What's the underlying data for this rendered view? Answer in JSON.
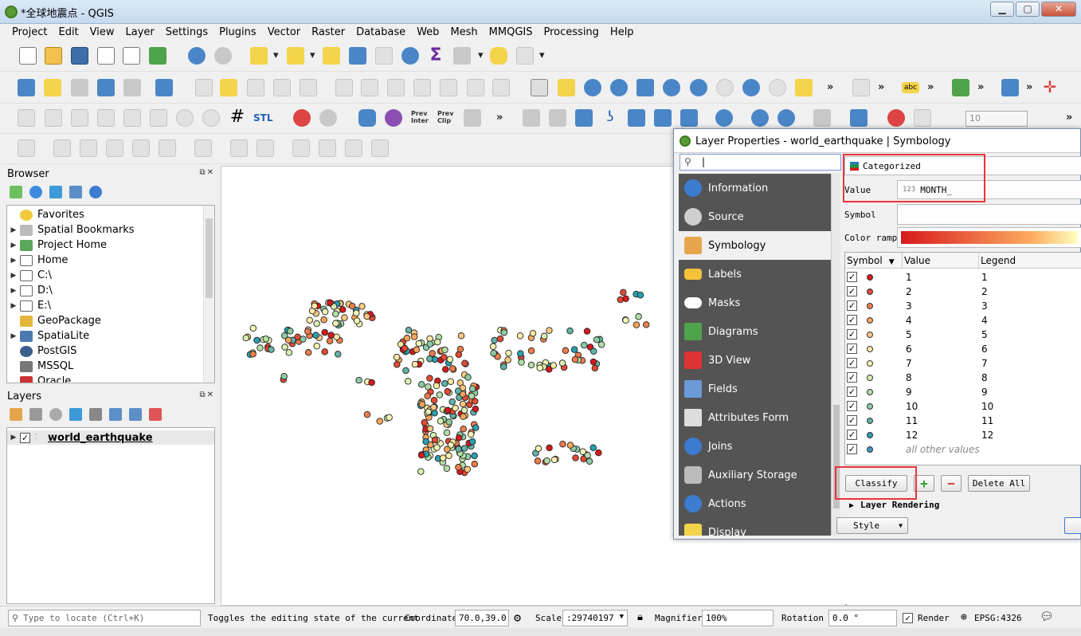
{
  "window": {
    "title": "*全球地震点 - QGIS",
    "min": "▁",
    "max": "▢",
    "close": "✕"
  },
  "menu": [
    "Project",
    "Edit",
    "View",
    "Layer",
    "Settings",
    "Plugins",
    "Vector",
    "Raster",
    "Database",
    "Web",
    "Mesh",
    "MMQGIS",
    "Processing",
    "Help"
  ],
  "toolbar": {
    "stl_label": "STL",
    "prev_inter": "Prev Inter",
    "prev_clip": "Prev Clip",
    "spin_value": "10",
    "more": "»",
    "abc": "abc"
  },
  "browser": {
    "title": "Browser",
    "items": [
      "Favorites",
      "Spatial Bookmarks",
      "Project Home",
      "Home",
      "C:\\",
      "D:\\",
      "E:\\",
      "GeoPackage",
      "SpatiaLite",
      "PostGIS",
      "MSSQL",
      "Oracle"
    ]
  },
  "layers": {
    "title": "Layers",
    "layer_name": "world_earthquake"
  },
  "dialog": {
    "title": "Layer Properties - world_earthquake | Symbology",
    "search_cursor": "|",
    "sidebar": [
      "Information",
      "Source",
      "Symbology",
      "Labels",
      "Masks",
      "Diagrams",
      "3D View",
      "Fields",
      "Attributes Form",
      "Joins",
      "Auxiliary Storage",
      "Actions",
      "Display"
    ],
    "renderer": "Categorized",
    "value_label": "Value",
    "value_type": "123",
    "value_field": "MONTH_",
    "symbol_label": "Symbol",
    "ramp_label": "Color ramp",
    "columns": [
      "Symbol",
      "Value",
      "Legend"
    ],
    "classes": [
      {
        "value": "1",
        "legend": "1",
        "color": "#d7191c"
      },
      {
        "value": "2",
        "legend": "2",
        "color": "#e34a33"
      },
      {
        "value": "3",
        "legend": "3",
        "color": "#f07c4a"
      },
      {
        "value": "4",
        "legend": "4",
        "color": "#f9a65a"
      },
      {
        "value": "5",
        "legend": "5",
        "color": "#fdc980"
      },
      {
        "value": "6",
        "legend": "6",
        "color": "#feeaa5"
      },
      {
        "value": "7",
        "legend": "7",
        "color": "#f4f6b6"
      },
      {
        "value": "8",
        "legend": "8",
        "color": "#d7efaf"
      },
      {
        "value": "9",
        "legend": "9",
        "color": "#b2dea6"
      },
      {
        "value": "10",
        "legend": "10",
        "color": "#8ccba4"
      },
      {
        "value": "11",
        "legend": "11",
        "color": "#62b2a8"
      },
      {
        "value": "12",
        "legend": "12",
        "color": "#2b9fb0"
      },
      {
        "value": "all other values",
        "legend": "",
        "color": "#3f96bb"
      }
    ],
    "classify": "Classify",
    "add": "+",
    "remove": "−",
    "delete_all": "Delete All",
    "layer_rendering": "Layer Rendering",
    "style": "Style"
  },
  "status": {
    "locate_placeholder": "Type to locate (Ctrl+K)",
    "message": "Toggles the editing state of the current",
    "coord_label": "Coordinate",
    "coord_value": "70.0,39.0",
    "scale_label": "Scale",
    "scale_value": ":29740197",
    "magnifier_label": "Magnifier",
    "magnifier_value": "100%",
    "rotation_label": "Rotation",
    "rotation_value": "0.0 °",
    "render_label": "Render",
    "crs": "EPSG:4326"
  }
}
